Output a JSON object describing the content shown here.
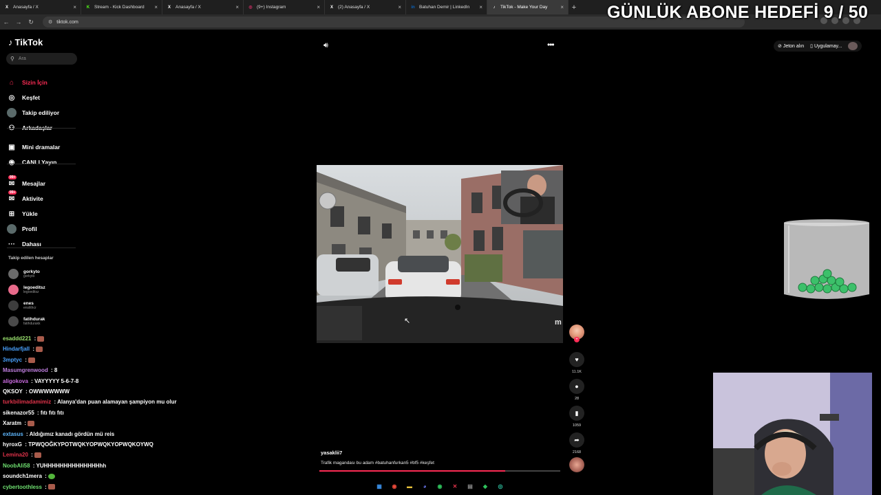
{
  "browser": {
    "tabs": [
      {
        "label": "Anasayfa / X",
        "icon": "x-icon",
        "active": false,
        "favicon": "X"
      },
      {
        "label": "Stream - Kick Dashboard",
        "icon": "kick-icon",
        "active": false,
        "favicon": "K"
      },
      {
        "label": "Anasayfa / X",
        "icon": "x-icon",
        "active": false,
        "favicon": "X"
      },
      {
        "label": "(9+) Instagram",
        "icon": "instagram-icon",
        "active": false,
        "favicon": "◎"
      },
      {
        "label": "(2) Anasayfa / X",
        "icon": "x-icon",
        "active": false,
        "favicon": "X"
      },
      {
        "label": "Batuhan Demir | LinkedIn",
        "icon": "linkedin-icon",
        "active": false,
        "favicon": "in"
      },
      {
        "label": "TikTok - Make Your Day",
        "icon": "tiktok-icon",
        "active": true,
        "favicon": "♪"
      }
    ],
    "url": "tiktok.com"
  },
  "overlay": {
    "goal": "GÜNLÜK ABONE HEDEFİ 9 / 50"
  },
  "sidebar": {
    "logo": "TikTok",
    "search_placeholder": "Ara",
    "items": [
      {
        "label": "Sizin İçin",
        "icon": "home-icon",
        "glyph": "⌂",
        "active": true
      },
      {
        "label": "Keşfet",
        "icon": "compass-icon",
        "glyph": "◎",
        "active": false
      },
      {
        "label": "Takip ediliyor",
        "icon": "following-avatar-icon",
        "glyph": "●",
        "active": false
      },
      {
        "label": "Arkadaşlar",
        "icon": "friends-icon",
        "glyph": "⚇",
        "active": false
      },
      {
        "label": "Mini dramalar",
        "icon": "mini-drama-icon",
        "glyph": "▣",
        "active": false
      },
      {
        "label": "CANLI Yayın",
        "icon": "live-icon",
        "glyph": "◉",
        "active": false
      },
      {
        "label": "Mesajlar",
        "icon": "messages-icon",
        "glyph": "✉",
        "badge": "99+",
        "active": false
      },
      {
        "label": "Aktivite",
        "icon": "activity-icon",
        "glyph": "✉",
        "badge": "99+",
        "active": false
      },
      {
        "label": "Yükle",
        "icon": "upload-icon",
        "glyph": "⊞",
        "active": false
      },
      {
        "label": "Profil",
        "icon": "profile-avatar-icon",
        "glyph": "●",
        "active": false
      },
      {
        "label": "Dahası",
        "icon": "more-dots-icon",
        "glyph": "···",
        "active": false
      }
    ],
    "following_title": "Takip edilen hesaplar",
    "following": [
      {
        "name": "gorkyto",
        "handle": "gorkyto",
        "color": "#6a6a6a"
      },
      {
        "name": "legoeditsz",
        "handle": "legoeditsz",
        "color": "#e86a8a"
      },
      {
        "name": "enes",
        "handle": "enslithcr",
        "color": "#3d3d3d"
      },
      {
        "name": "fatihdurak",
        "handle": "fatihdurakk",
        "color": "#4a4a4a"
      }
    ]
  },
  "topbar": {
    "coins_label": "Jeton alın",
    "app_label": "Uygulamay..."
  },
  "video": {
    "author": "yasaklii7",
    "description": "Trafik magandası bu adam #batuhanfurkan5 #bf5 #keşfet",
    "progress": 0.77,
    "likes": "11.1K",
    "comments": "28",
    "saves": "1059",
    "shares": "2168"
  },
  "chat": [
    {
      "user": "esaddd221",
      "text": "",
      "color": "#9be36f",
      "emote": true
    },
    {
      "user": "Hindarfjall",
      "text": "",
      "color": "#4aa3ff",
      "emote": true
    },
    {
      "user": "3mptyc",
      "text": "",
      "color": "#4aa3ff",
      "emote": true
    },
    {
      "user": "Masumgrenwood",
      "text": "8",
      "color": "#c07fe0",
      "emote": false
    },
    {
      "user": "aligokova",
      "text": "VAYYYYY 5-6-7-8",
      "color": "#c96adf",
      "emote": false
    },
    {
      "user": "QKSOY",
      "text": "OWWWWWWW",
      "color": "#ffffff",
      "emote": false
    },
    {
      "user": "turkbilimadamimiz",
      "text": "Alanya'dan puan alamayan şampiyon mu olur",
      "color": "#e0334a",
      "emote": false
    },
    {
      "user": "sikenazor55",
      "text": "fıtı fıtı fıtı",
      "color": "#ffffff",
      "emote": false
    },
    {
      "user": "Xaratm",
      "text": "",
      "color": "#ffffff",
      "emote": true
    },
    {
      "user": "extasus",
      "text": "Aldığımız kanadı gördün mü reis",
      "color": "#5fb8ff",
      "emote": false
    },
    {
      "user": "hyroxG",
      "text": "TPWQOĞKYPOTWQKYOPWQKYOPWQKOYWQ",
      "color": "#ffffff",
      "emote": false
    },
    {
      "user": "Lemina20",
      "text": "",
      "color": "#e0334a",
      "emote": true
    },
    {
      "user": "NoobAli58",
      "text": "YUHHHHHHHHHHHHHHhh",
      "color": "#6fe070",
      "emote": false
    },
    {
      "user": "soundch1mera",
      "text": "",
      "color": "#ffffff",
      "emote": true
    },
    {
      "user": "cybertoothless",
      "text": "",
      "color": "#6fe070",
      "emote": true
    }
  ],
  "taskbar": [
    {
      "name": "windows-start-icon",
      "glyph": "▦",
      "color": "#3a8fe8"
    },
    {
      "name": "chrome-icon",
      "glyph": "◉",
      "color": "#e8493a"
    },
    {
      "name": "file-explorer-icon",
      "glyph": "▬",
      "color": "#e8c13a"
    },
    {
      "name": "discord-icon",
      "glyph": "◕",
      "color": "#6a78ef"
    },
    {
      "name": "spotify-icon",
      "glyph": "◉",
      "color": "#2ec05b"
    },
    {
      "name": "x-app-icon",
      "glyph": "✕",
      "color": "#e0334a"
    },
    {
      "name": "calculator-icon",
      "glyph": "▤",
      "color": "#8a8a8a"
    },
    {
      "name": "game-app-icon",
      "glyph": "◆",
      "color": "#2ec05b"
    },
    {
      "name": "search-app-icon",
      "glyph": "◎",
      "color": "#2ec0a0"
    }
  ]
}
